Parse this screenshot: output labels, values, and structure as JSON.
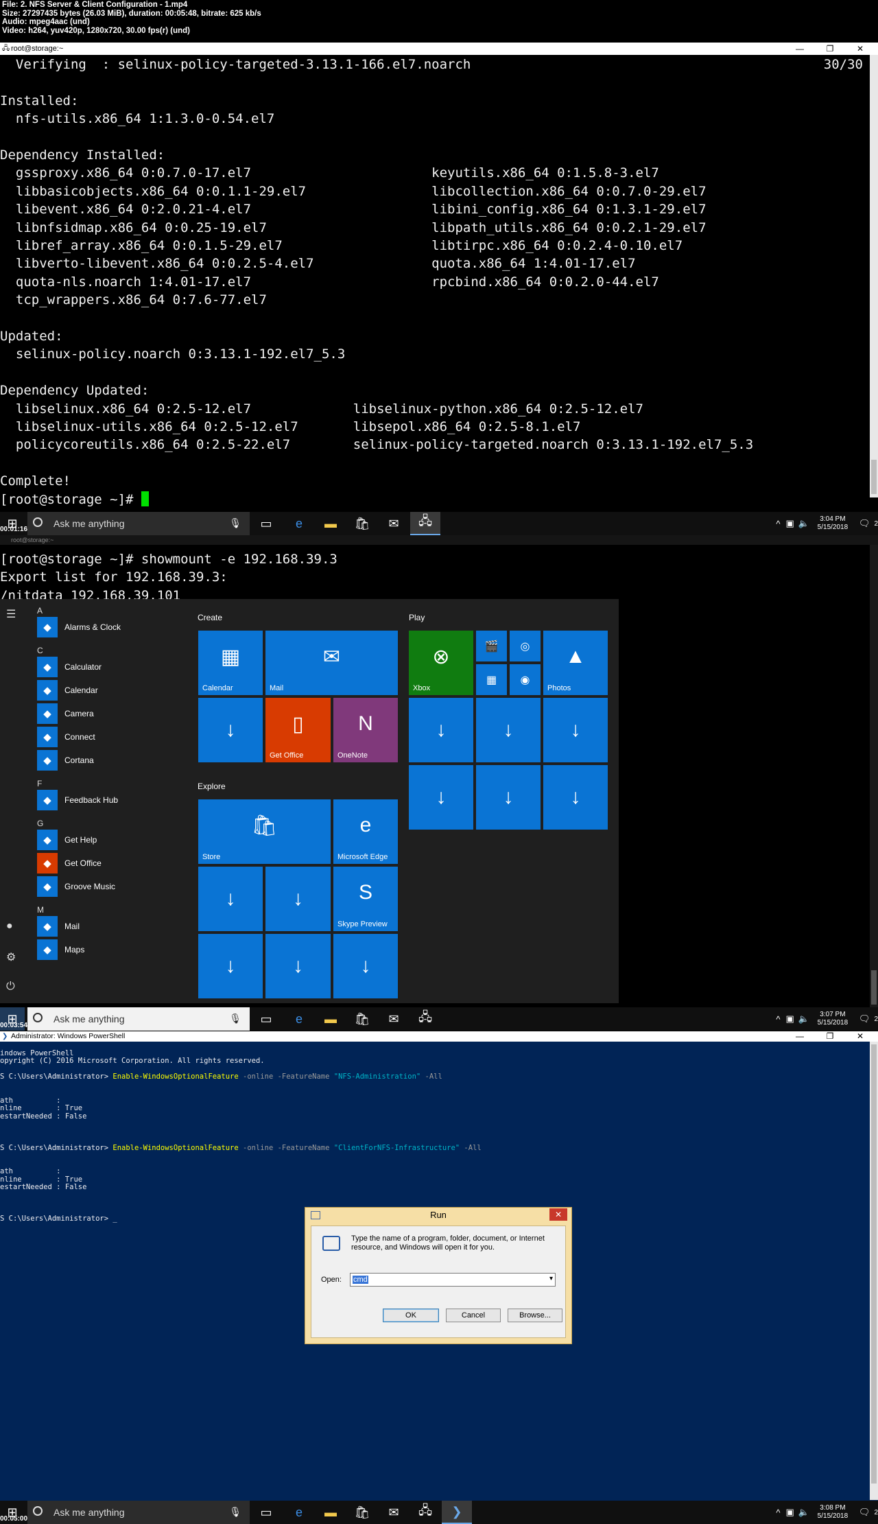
{
  "media_info": [
    "File: 2. NFS Server & Client Configuration - 1.mp4",
    "Size: 27297435 bytes (26.03 MiB), duration: 00:05:48, bitrate: 625 kb/s",
    "Audio: mpeg4aac (und)",
    "Video: h264, yuv420p, 1280x720, 30.00 fps(r) (und)"
  ],
  "frame1": {
    "window_title": "root@storage:~",
    "progress": "30/30",
    "lines": [
      "  Verifying  : selinux-policy-targeted-3.13.1-166.el7.noarch",
      "",
      "Installed:",
      "  nfs-utils.x86_64 1:1.3.0-0.54.el7",
      "",
      "Dependency Installed:",
      "  gssproxy.x86_64 0:0.7.0-17.el7                       keyutils.x86_64 0:1.5.8-3.el7",
      "  libbasicobjects.x86_64 0:0.1.1-29.el7                libcollection.x86_64 0:0.7.0-29.el7",
      "  libevent.x86_64 0:2.0.21-4.el7                       libini_config.x86_64 0:1.3.1-29.el7",
      "  libnfsidmap.x86_64 0:0.25-19.el7                     libpath_utils.x86_64 0:0.2.1-29.el7",
      "  libref_array.x86_64 0:0.1.5-29.el7                   libtirpc.x86_64 0:0.2.4-0.10.el7",
      "  libverto-libevent.x86_64 0:0.2.5-4.el7               quota.x86_64 1:4.01-17.el7",
      "  quota-nls.noarch 1:4.01-17.el7                       rpcbind.x86_64 0:0.2.0-44.el7",
      "  tcp_wrappers.x86_64 0:7.6-77.el7",
      "",
      "Updated:",
      "  selinux-policy.noarch 0:3.13.1-192.el7_5.3",
      "",
      "Dependency Updated:",
      "  libselinux.x86_64 0:2.5-12.el7             libselinux-python.x86_64 0:2.5-12.el7",
      "  libselinux-utils.x86_64 0:2.5-12.el7       libsepol.x86_64 0:2.5-8.1.el7",
      "  policycoreutils.x86_64 0:2.5-22.el7        selinux-policy-targeted.noarch 0:3.13.1-192.el7_5.3",
      "",
      "Complete!"
    ],
    "prompt": "[root@storage ~]# ",
    "timestamp": "00:01:16",
    "clock_time": "3:04 PM",
    "clock_date": "5/15/2018"
  },
  "frame2": {
    "window_title": "root@storage:~",
    "lines": [
      "[root@storage ~]# showmount -e 192.168.39.3",
      "Export list for 192.168.39.3:",
      "/nitdata 192.168.39.101"
    ],
    "timestamp": "00:03:54",
    "clock_time": "3:07 PM",
    "clock_date": "5/15/2018",
    "start_menu": {
      "sections": [
        {
          "letter": "A",
          "items": [
            {
              "label": "Alarms & Clock",
              "icon": "clock-icon"
            }
          ]
        },
        {
          "letter": "C",
          "items": [
            {
              "label": "Calculator",
              "icon": "calculator-icon"
            },
            {
              "label": "Calendar",
              "icon": "calendar-icon"
            },
            {
              "label": "Camera",
              "icon": "camera-icon"
            },
            {
              "label": "Connect",
              "icon": "connect-icon"
            },
            {
              "label": "Cortana",
              "icon": "cortana-icon"
            }
          ]
        },
        {
          "letter": "F",
          "items": [
            {
              "label": "Feedback Hub",
              "icon": "feedback-icon"
            }
          ]
        },
        {
          "letter": "G",
          "items": [
            {
              "label": "Get Help",
              "icon": "help-icon"
            },
            {
              "label": "Get Office",
              "icon": "office-icon"
            },
            {
              "label": "Groove Music",
              "icon": "music-icon"
            }
          ]
        },
        {
          "letter": "M",
          "items": [
            {
              "label": "Mail",
              "icon": "mail-icon"
            },
            {
              "label": "Maps",
              "icon": "maps-icon"
            }
          ]
        }
      ],
      "groups": {
        "create": "Create",
        "explore": "Explore",
        "play": "Play"
      },
      "tiles": {
        "calendar": "Calendar",
        "mail": "Mail",
        "get_office": "Get Office",
        "onenote": "OneNote",
        "store": "Store",
        "edge": "Microsoft Edge",
        "skype": "Skype Preview",
        "xbox": "Xbox",
        "photos": "Photos"
      }
    }
  },
  "frame3": {
    "window_title": "Administrator: Windows PowerShell",
    "header_lines": [
      "indows PowerShell",
      "opyright (C) 2016 Microsoft Corporation. All rights reserved."
    ],
    "prompt": "S C:\\Users\\Administrator> ",
    "commands": [
      {
        "cmdlet": "Enable-WindowsOptionalFeature",
        "args1": " -online -FeatureName ",
        "feature": "\"NFS-Administration\"",
        "args2": " -All"
      },
      {
        "cmdlet": "Enable-WindowsOptionalFeature",
        "args1": " -online -FeatureName ",
        "feature": "\"ClientForNFS-Infrastructure\"",
        "args2": " -All"
      }
    ],
    "result_lines": [
      "ath          :",
      "nline        : True",
      "estartNeeded : False"
    ],
    "run_dialog": {
      "title": "Run",
      "description": "Type the name of a program, folder, document, or Internet resource, and Windows will open it for you.",
      "open_label": "Open:",
      "open_value": "cmd",
      "ok": "OK",
      "cancel": "Cancel",
      "browse": "Browse..."
    },
    "timestamp": "00:05:00",
    "clock_time": "3:08 PM",
    "clock_date": "5/15/2018"
  },
  "taskbar": {
    "search_placeholder": "Ask me anything",
    "notification_count": "2"
  }
}
